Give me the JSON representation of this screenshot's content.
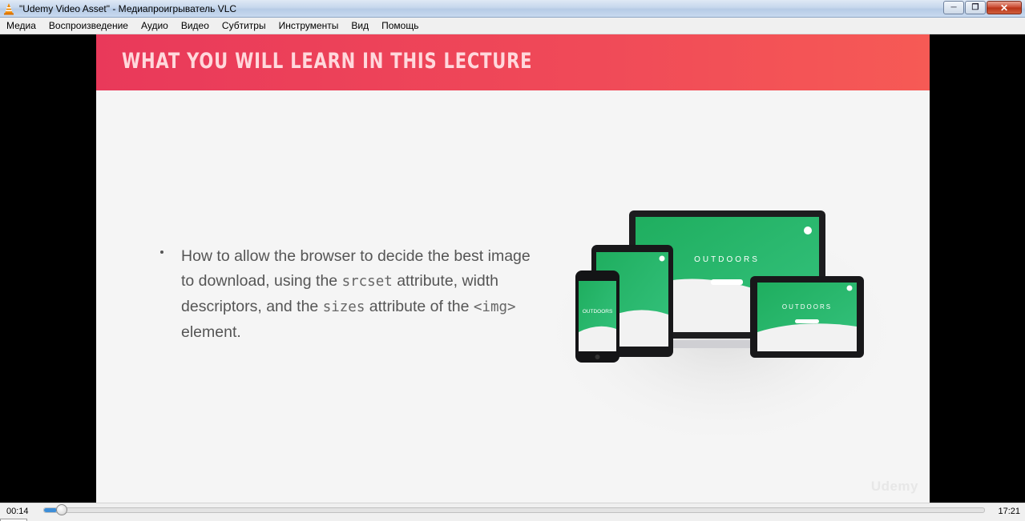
{
  "window": {
    "title": "\"Udemy Video Asset\" - Медиапроигрыватель VLC",
    "icon": "vlc-cone-icon",
    "buttons": {
      "minimize_icon": "minimize-icon",
      "maximize_icon": "restore-icon",
      "close_icon": "close-icon"
    }
  },
  "menu": [
    "Медиа",
    "Воспроизведение",
    "Аудио",
    "Видео",
    "Субтитры",
    "Инструменты",
    "Вид",
    "Помощь"
  ],
  "slide": {
    "title": "WHAT YOU WILL LEARN IN THIS LECTURE",
    "bullet": {
      "part1": "How to allow the browser to decide the best image to download, using the ",
      "code1": "srcset",
      "part2": " attribute, width descriptors, and the ",
      "code2": "sizes",
      "part3": " attribute of the ",
      "code3": "<img>",
      "part4": " element."
    },
    "device_brand_text": "OUTDOORS",
    "watermark": "Udemy",
    "colors": {
      "header_start": "#e9395a",
      "header_end": "#f65a55",
      "screen_green": "#26b56a"
    }
  },
  "player": {
    "current_time": "00:14",
    "total_time": "17:21",
    "progress": 0.0134
  }
}
